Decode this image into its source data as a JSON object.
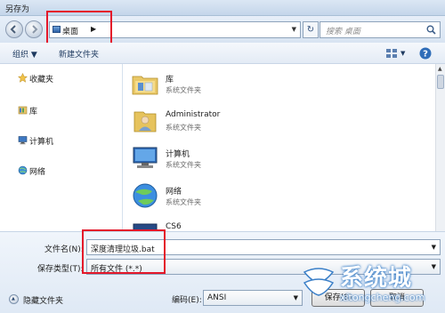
{
  "window": {
    "title": "另存为"
  },
  "nav": {
    "breadcrumb": "桌面",
    "crumb_arrow": "▶",
    "search_placeholder": "搜索 桌面"
  },
  "toolbar": {
    "organize": "组织 ▼",
    "new_folder": "新建文件夹"
  },
  "sidebar": {
    "items": [
      {
        "label": "收藏夹",
        "icon": "star-icon"
      },
      {
        "label": "库",
        "icon": "library-icon"
      },
      {
        "label": "计算机",
        "icon": "computer-icon"
      },
      {
        "label": "网络",
        "icon": "network-icon"
      }
    ]
  },
  "files": {
    "items": [
      {
        "name": "库",
        "type": "系统文件夹",
        "icon": "library-folder-icon"
      },
      {
        "name": "Administrator",
        "type": "系统文件夹",
        "icon": "user-folder-icon"
      },
      {
        "name": "计算机",
        "type": "系统文件夹",
        "icon": "computer-icon"
      },
      {
        "name": "网络",
        "type": "系统文件夹",
        "icon": "network-icon"
      },
      {
        "name": "CS6",
        "type": "",
        "icon": "folder-icon"
      }
    ]
  },
  "form": {
    "filename_label": "文件名(N):",
    "filename_value": "深度清理垃圾.bat",
    "filetype_label": "保存类型(T):",
    "filetype_value": "所有文件 (*.*)",
    "hide_folders": "隐藏文件夹",
    "encoding_label": "编码(E):",
    "encoding_value": "ANSI",
    "save_button": "保存(S)",
    "cancel_button": "取消"
  },
  "watermark": {
    "text": "系统城",
    "url": "xitongcheng.com"
  },
  "colors": {
    "highlight_box": "#e4172a",
    "watermark": "#3a7fc8"
  }
}
